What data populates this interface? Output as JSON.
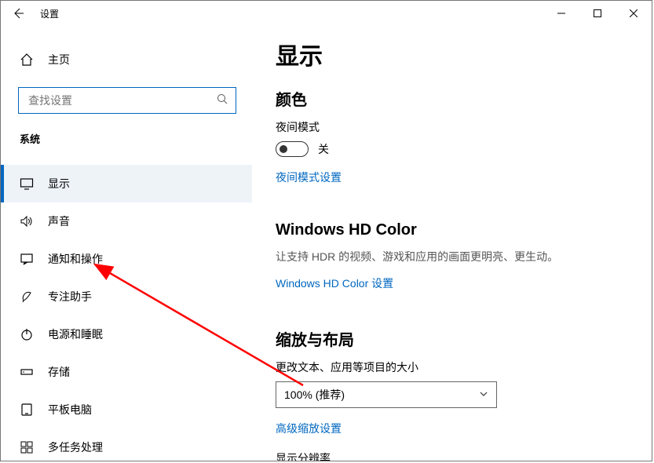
{
  "window": {
    "title": "设置"
  },
  "sidebar": {
    "home_label": "主页",
    "search_placeholder": "查找设置",
    "category_label": "系统",
    "items": [
      {
        "label": "显示",
        "icon": "monitor-icon",
        "selected": true
      },
      {
        "label": "声音",
        "icon": "sound-icon"
      },
      {
        "label": "通知和操作",
        "icon": "notification-icon"
      },
      {
        "label": "专注助手",
        "icon": "focus-assist-icon"
      },
      {
        "label": "电源和睡眠",
        "icon": "power-icon"
      },
      {
        "label": "存储",
        "icon": "storage-icon"
      },
      {
        "label": "平板电脑",
        "icon": "tablet-icon"
      },
      {
        "label": "多任务处理",
        "icon": "multitask-icon"
      }
    ]
  },
  "main": {
    "page_title": "显示",
    "color": {
      "section_title": "颜色",
      "night_light_label": "夜间模式",
      "night_light_state": "关",
      "night_light_link": "夜间模式设置"
    },
    "hdcolor": {
      "section_title": "Windows HD Color",
      "desc": "让支持 HDR 的视频、游戏和应用的画面更明亮、更生动。",
      "link": "Windows HD Color 设置"
    },
    "scale": {
      "section_title": "缩放与布局",
      "field_label": "更改文本、应用等项目的大小",
      "selected_value": "100% (推荐)",
      "advanced_link": "高级缩放设置",
      "resolution_label_cut": "显示分辨率"
    }
  }
}
